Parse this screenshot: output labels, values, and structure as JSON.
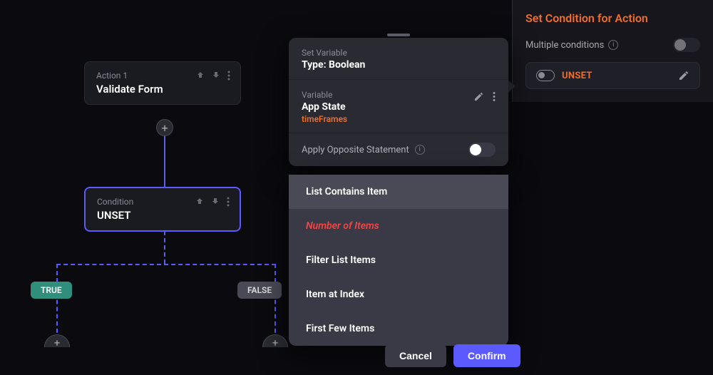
{
  "canvas": {
    "action_card": {
      "label": "Action 1",
      "title": "Validate Form"
    },
    "condition_card": {
      "label": "Condition",
      "title": "UNSET"
    },
    "branches": {
      "true": "TRUE",
      "false": "FALSE"
    }
  },
  "popover": {
    "set_variable_label": "Set Variable",
    "set_variable_title": "Type: Boolean",
    "variable_label": "Variable",
    "variable_title": "App State",
    "variable_sub": "timeFrames",
    "apply_opposite": "Apply Opposite Statement"
  },
  "dropdown": {
    "items": [
      {
        "label": "List Contains Item",
        "hl": true
      },
      {
        "label": "Number of Items",
        "number": true
      },
      {
        "label": "Filter List Items"
      },
      {
        "label": "Item at Index"
      },
      {
        "label": "First Few Items"
      }
    ]
  },
  "footer": {
    "cancel": "Cancel",
    "confirm": "Confirm"
  },
  "rpanel": {
    "title": "Set Condition for Action",
    "multiple": "Multiple conditions",
    "chip": "UNSET"
  },
  "glyphs": {
    "plus": "+",
    "info": "i"
  }
}
